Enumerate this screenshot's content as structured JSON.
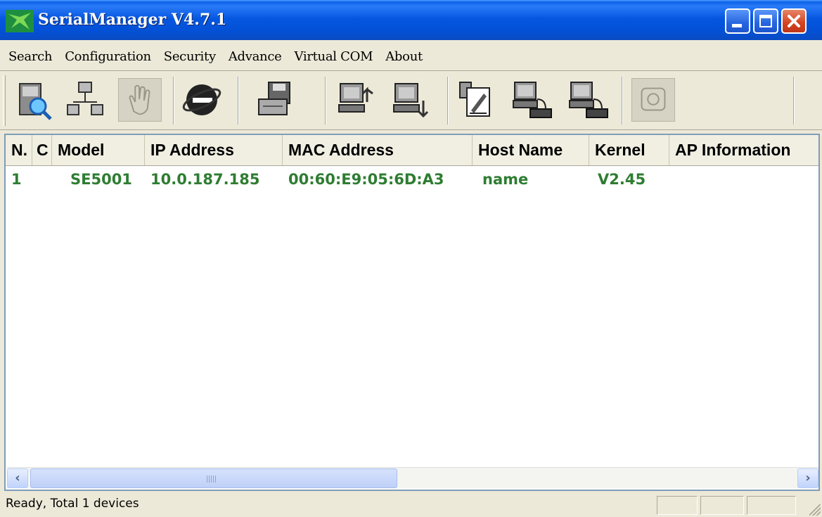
{
  "window": {
    "title": "SerialManager V4.7.1",
    "buttons": [
      "minimize",
      "maximize",
      "close"
    ]
  },
  "menu": [
    "Search",
    "Configuration",
    "Security",
    "Advance",
    "Virtual COM",
    "About"
  ],
  "toolbar": {
    "tools": [
      {
        "name": "search-tool-icon",
        "enabled": true
      },
      {
        "name": "network-config-icon",
        "enabled": true
      },
      {
        "name": "hand-icon",
        "enabled": false
      },
      {
        "name": "internet-explorer-icon",
        "enabled": true
      },
      {
        "name": "save-export-icon",
        "enabled": true
      },
      {
        "name": "upload-computer-icon",
        "enabled": true
      },
      {
        "name": "download-computer-icon",
        "enabled": true
      },
      {
        "name": "document-edit-icon",
        "enabled": true
      },
      {
        "name": "computer-serial-device-icon",
        "enabled": true
      },
      {
        "name": "computer-serial-device-icon-2",
        "enabled": true
      },
      {
        "name": "telephone-icon",
        "enabled": false
      }
    ]
  },
  "table": {
    "columns": [
      "N.",
      "C",
      "Model",
      "IP Address",
      "MAC Address",
      "Host Name",
      "Kernel",
      "AP Information"
    ],
    "rows": [
      [
        "1",
        "",
        "SE5001",
        "10.0.187.185",
        "00:60:E9:05:6D:A3",
        "name",
        "V2.45",
        ""
      ]
    ],
    "row_color": "#2e7d32"
  },
  "scrollbar": {
    "grip": "III"
  },
  "status": {
    "text": "Ready, Total 1 devices"
  },
  "colors": {
    "titlebar": "#0556e0",
    "close_button": "#d4421e",
    "face": "#ece9d8"
  }
}
